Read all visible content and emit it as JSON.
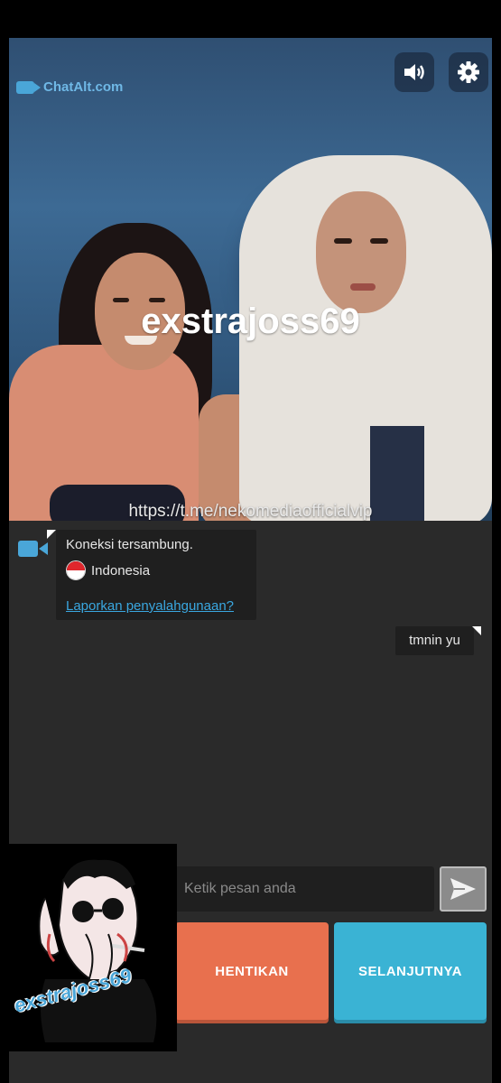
{
  "video": {
    "logo_text": "ChatAlt.com",
    "watermark": "exstrajoss69",
    "url": "https://t.me/nekomediaofficialvip",
    "controls": {
      "volume_icon": "volume-icon",
      "settings_icon": "gear-icon"
    }
  },
  "chat": {
    "system": {
      "status": "Koneksi tersambung.",
      "country": "Indonesia",
      "report_link": "Laporkan penyalahgunaan?"
    },
    "messages": [
      {
        "from": "me",
        "text": "tmnin yu"
      }
    ]
  },
  "input": {
    "placeholder": "Ketik pesan anda"
  },
  "buttons": {
    "stop": "HENTIKAN",
    "next": "SELANJUTNYA"
  },
  "selfview": {
    "caption": "exstrajoss69"
  },
  "colors": {
    "stop": "#e8704e",
    "next": "#3ab3d4",
    "link": "#3aa7e0",
    "background": "#2a2a2a"
  }
}
